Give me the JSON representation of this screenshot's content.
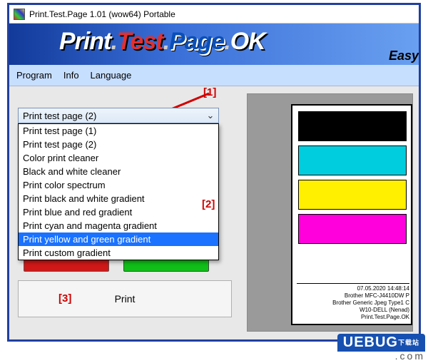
{
  "window": {
    "title": "Print.Test.Page 1.01  (wow64) Portable"
  },
  "banner": {
    "w1": "Print",
    "w2": "Test",
    "w3": "Page",
    "w4": "OK",
    "easy": "Easy"
  },
  "menu": {
    "program": "Program",
    "info": "Info",
    "language": "Language"
  },
  "annot": {
    "a1": "[1]",
    "a2": "[2]",
    "a3": "[3]"
  },
  "combo": {
    "selected": "Print test page (2)",
    "options": [
      "Print test page (1)",
      "Print test page (2)",
      "Color print cleaner",
      "Black and white cleaner",
      "Print color spectrum",
      "Print black and white gradient",
      "Print blue and red gradient",
      "Print cyan and magenta gradient",
      "Print yellow and green gradient",
      "Print custom gradient"
    ],
    "highlighted_index": 8
  },
  "print_button": "Print",
  "preview": {
    "meta": [
      "07.05.2020 14:48:14",
      "Brother MFC-J4410DW P",
      "Brother Generic Jpeg Type1 C",
      "W10-DELL (Nenad)",
      "Print.Test.Page.OK"
    ]
  },
  "watermark": {
    "brand": "UEBUG",
    "tag": "下载站",
    "suffix": ".com"
  }
}
